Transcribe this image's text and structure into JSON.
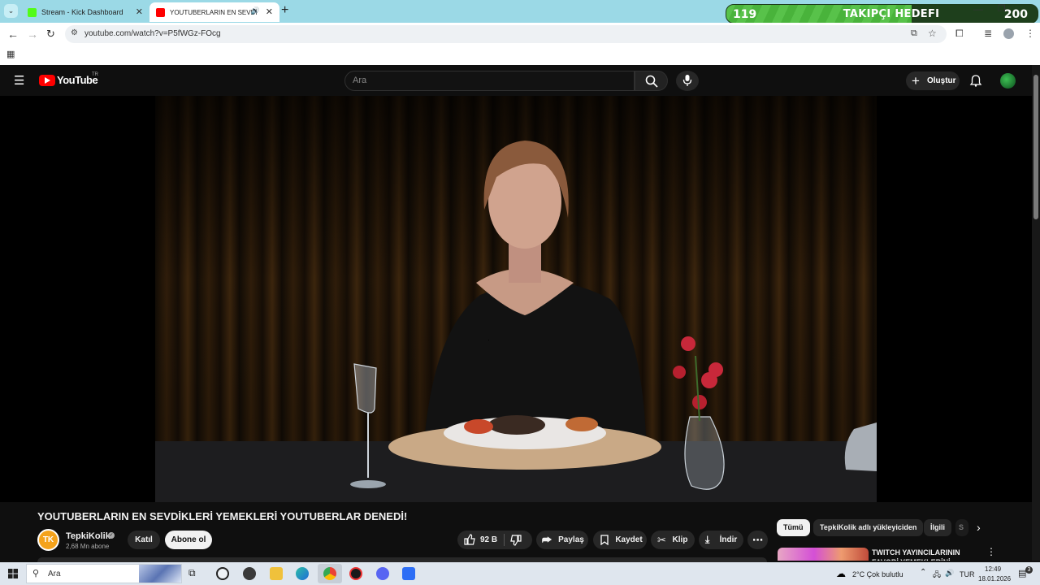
{
  "browser": {
    "tabs": [
      {
        "title": "Stream - Kick Dashboard",
        "active": false
      },
      {
        "title": "YOUTUBERLARIN EN SEVDİ",
        "active": true
      }
    ],
    "url": "youtube.com/watch?v=P5fWGz-FOcg",
    "new_tab_symbol": "+"
  },
  "overlay": {
    "current": "119",
    "title": "TAKIPÇI HEDEFI",
    "target": "200",
    "progress": 0.595
  },
  "youtube": {
    "logo_text": "YouTube",
    "logo_region": "TR",
    "search_placeholder": "Ara",
    "create_label": "Oluştur",
    "video_title": "YOUTUBERLARIN EN SEVDİKLERİ YEMEKLERİ YOUTUBERLAR DENEDİ!",
    "channel": {
      "avatar_text": "TK",
      "name": "TepkiKolik",
      "subscribers": "2,68 Mn abone"
    },
    "join_label": "Katıl",
    "subscribe_label": "Abone ol",
    "likes": "92 B",
    "share_label": "Paylaş",
    "save_label": "Kaydet",
    "clip_label": "Klip",
    "download_label": "İndir",
    "chips": [
      "Tümü",
      "TepkiKolik adlı yükleyiciden",
      "İlgili",
      "S"
    ],
    "recommendation": {
      "title": "TWITCH YAYINCILARININ FAVORİ YEMEKLERİNİ DENEDİK!"
    }
  },
  "taskbar": {
    "search_label": "Ara",
    "weather": "2°C  Çok bulutlu",
    "language": "TUR",
    "time": "12:49",
    "date": "18.01.2026",
    "notification_count": "3"
  },
  "colors": {
    "kick_green": "#53fc18",
    "youtube_red": "#ff0000",
    "goal_green": "#58c24a",
    "tab_strip": "#9bd9e6"
  }
}
